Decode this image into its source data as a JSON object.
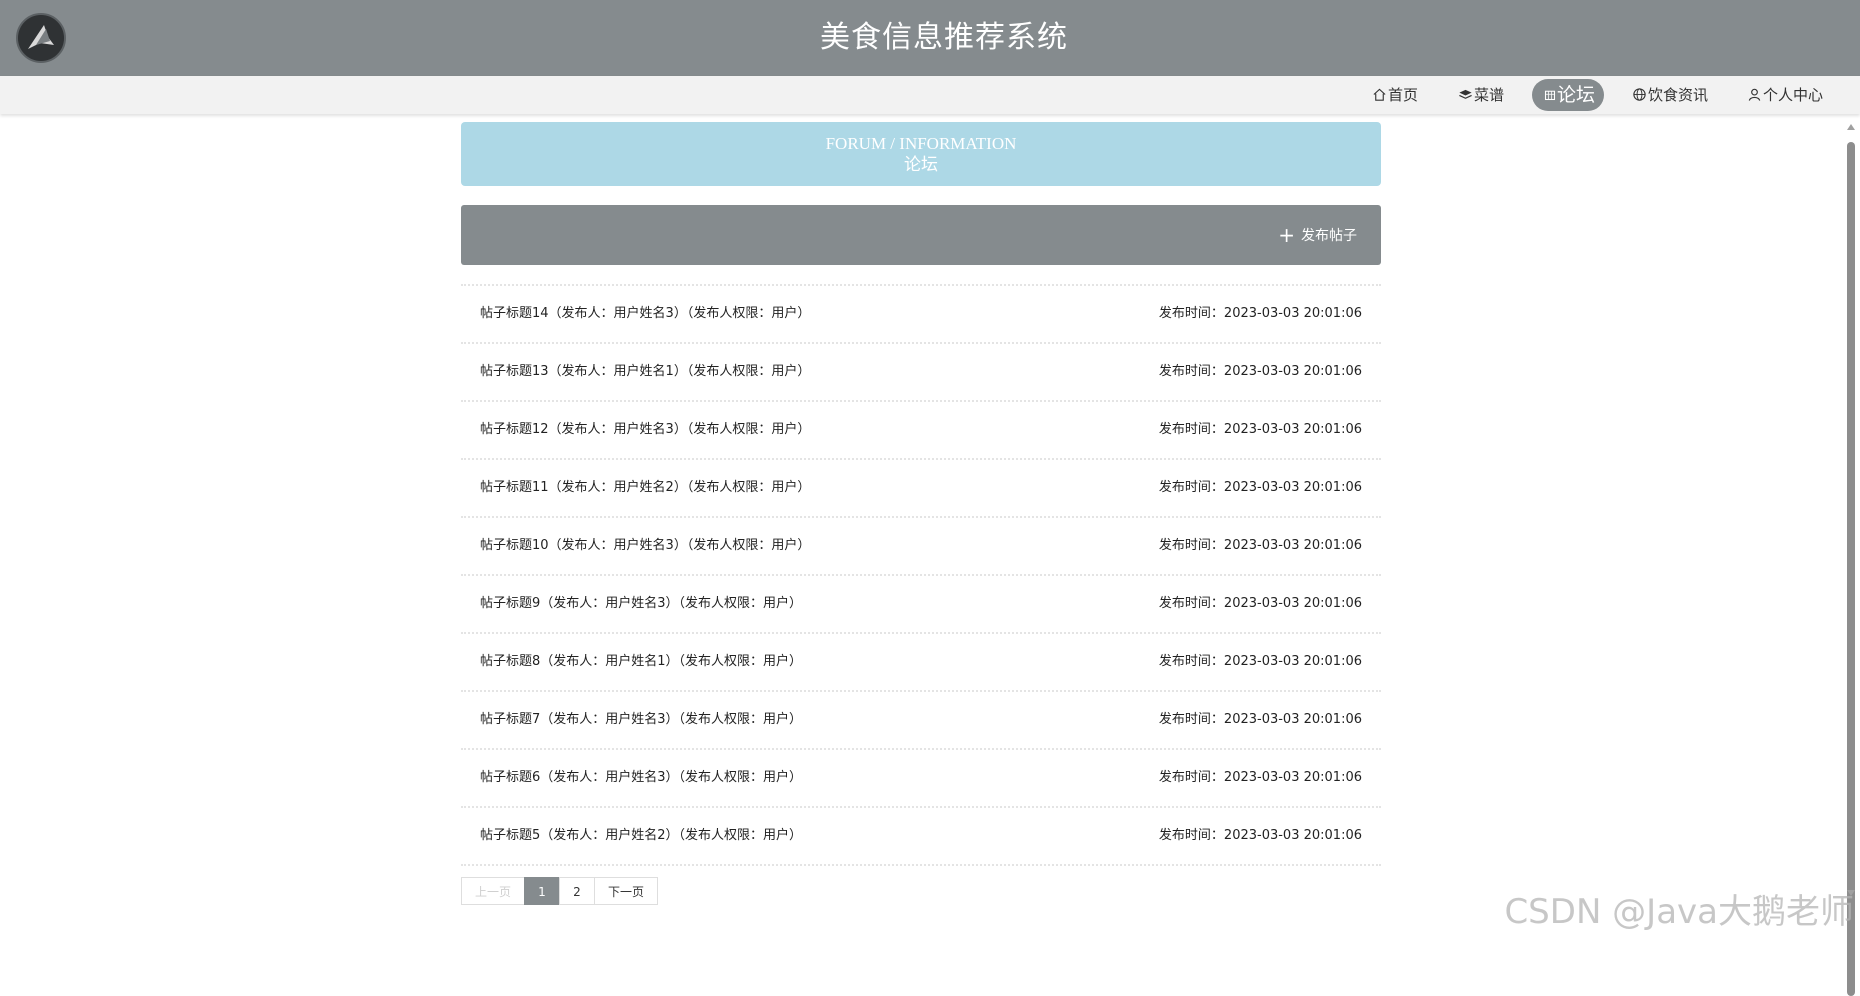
{
  "header": {
    "site_title": "美食信息推荐系统",
    "logo_icon": "logo-avatar-icon"
  },
  "nav": {
    "items": [
      {
        "label": "首页",
        "icon": "home-icon",
        "active": false
      },
      {
        "label": "菜谱",
        "icon": "layers-icon",
        "active": false
      },
      {
        "label": "论坛",
        "icon": "forum-icon",
        "active": true
      },
      {
        "label": "饮食资讯",
        "icon": "globe-icon",
        "active": false
      },
      {
        "label": "个人中心",
        "icon": "user-icon",
        "active": false
      }
    ]
  },
  "banner": {
    "en": "FORUM / INFORMATION",
    "cn": "论坛"
  },
  "toolbar": {
    "post_button_label": "发布帖子"
  },
  "posts": [
    {
      "title": "帖子标题14（发布人：用户姓名3）（发布人权限：用户）",
      "time": "发布时间：2023-03-03 20:01:06"
    },
    {
      "title": "帖子标题13（发布人：用户姓名1）（发布人权限：用户）",
      "time": "发布时间：2023-03-03 20:01:06"
    },
    {
      "title": "帖子标题12（发布人：用户姓名3）（发布人权限：用户）",
      "time": "发布时间：2023-03-03 20:01:06"
    },
    {
      "title": "帖子标题11（发布人：用户姓名2）（发布人权限：用户）",
      "time": "发布时间：2023-03-03 20:01:06"
    },
    {
      "title": "帖子标题10（发布人：用户姓名3）（发布人权限：用户）",
      "time": "发布时间：2023-03-03 20:01:06"
    },
    {
      "title": "帖子标题9（发布人：用户姓名3）（发布人权限：用户）",
      "time": "发布时间：2023-03-03 20:01:06"
    },
    {
      "title": "帖子标题8（发布人：用户姓名1）（发布人权限：用户）",
      "time": "发布时间：2023-03-03 20:01:06"
    },
    {
      "title": "帖子标题7（发布人：用户姓名3）（发布人权限：用户）",
      "time": "发布时间：2023-03-03 20:01:06"
    },
    {
      "title": "帖子标题6（发布人：用户姓名3）（发布人权限：用户）",
      "time": "发布时间：2023-03-03 20:01:06"
    },
    {
      "title": "帖子标题5（发布人：用户姓名2）（发布人权限：用户）",
      "time": "发布时间：2023-03-03 20:01:06"
    }
  ],
  "pagination": {
    "prev": "上一页",
    "pages": [
      "1",
      "2"
    ],
    "current_page": "1",
    "next": "下一页"
  },
  "watermark": "CSDN @Java大鹅老师",
  "colors": {
    "primary_gray": "#858b8e",
    "banner_blue": "#add8e6",
    "nav_bg": "#f2f2f2"
  }
}
